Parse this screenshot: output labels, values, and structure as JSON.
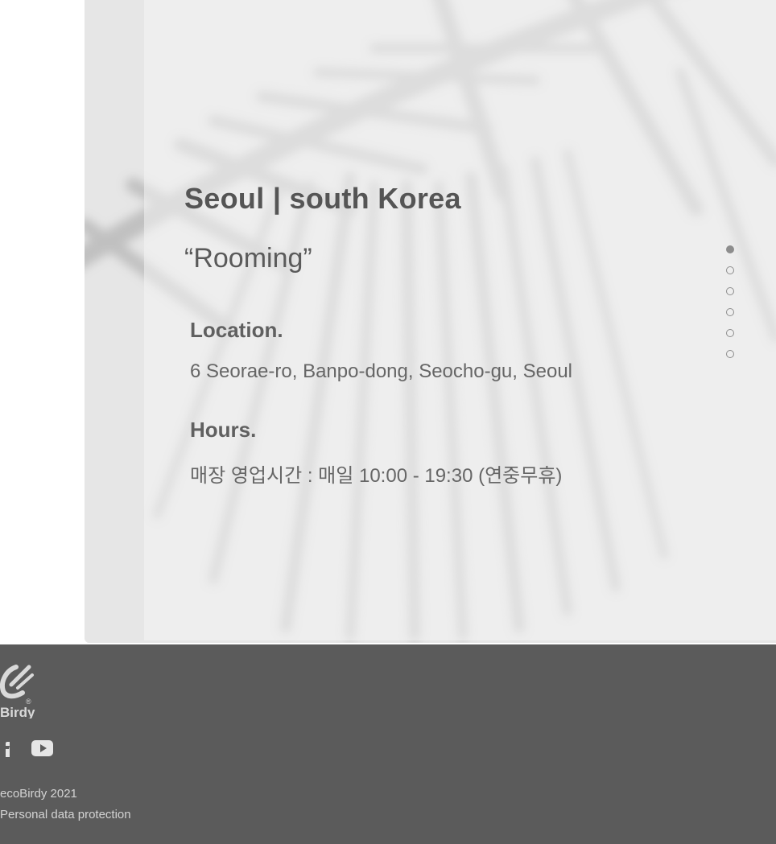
{
  "store": {
    "title": "Seoul | south Korea",
    "subtitle": "“Rooming”",
    "location_label": "Location.",
    "location_value": "6 Seorae-ro, Banpo-dong, Seocho-gu, Seoul",
    "hours_label": "Hours.",
    "hours_value": "매장 영업시간 : 매일 10:00 - 19:30 (연중무휴)"
  },
  "pagination": {
    "count": 6,
    "active_index": 0
  },
  "footer": {
    "logo_text": "Birdy",
    "logo_mark": "®",
    "social_icons": [
      "facebook-icon",
      "youtube-icon"
    ],
    "copyright": "ecoBirdy 2021",
    "privacy_link": "Personal data protection"
  },
  "colors": {
    "hero_bg": "#e9e9e9",
    "footer_bg": "#5b5b5b",
    "text_dark": "#555555"
  }
}
